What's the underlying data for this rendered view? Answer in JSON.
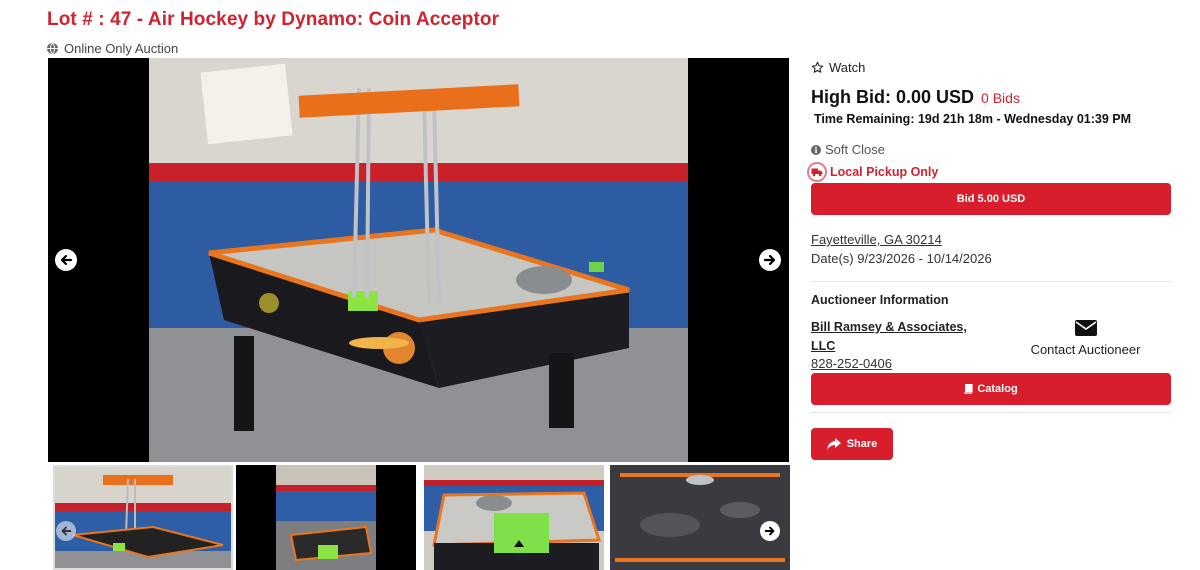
{
  "lot": {
    "title": "Lot # : 47 - Air Hockey by Dynamo: Coin Acceptor",
    "auction_type": "Online Only Auction"
  },
  "gallery": {
    "thumbnails": [
      {
        "icon": "air-hockey-photo-1",
        "active": true
      },
      {
        "icon": "air-hockey-photo-2"
      },
      {
        "icon": "air-hockey-photo-3"
      },
      {
        "icon": "air-hockey-photo-4"
      }
    ]
  },
  "bidding": {
    "watch_label": "Watch",
    "high_bid_label": "High Bid: 0.00 USD",
    "bids_count": "0 Bids",
    "time_remaining": "Time Remaining: 19d 21h 18m - Wednesday 01:39 PM",
    "soft_close": "Soft Close",
    "local_pickup": "Local Pickup Only",
    "bid_button": "Bid 5.00 USD"
  },
  "location": {
    "city": "Fayetteville, GA 30214",
    "dates": "Date(s) 9/23/2026 - 10/14/2026"
  },
  "auctioneer": {
    "heading": "Auctioneer Information",
    "name": "Bill Ramsey & Associates, LLC",
    "phone": "828-252-0406",
    "contact_label": "Contact Auctioneer"
  },
  "actions": {
    "catalog_label": "Catalog",
    "share_label": "Share"
  },
  "colors": {
    "accent": "#d81e2c",
    "title": "#d3222f"
  }
}
